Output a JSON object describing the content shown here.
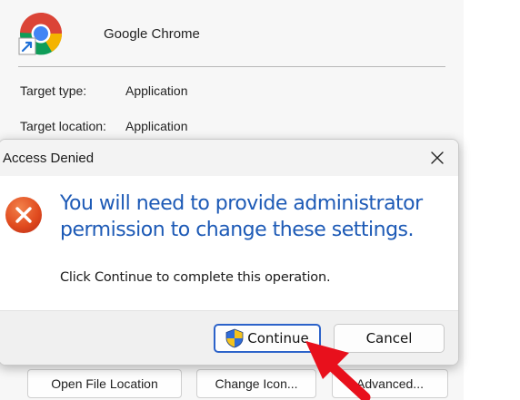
{
  "properties_window": {
    "app_name": "Google Chrome",
    "rows": [
      {
        "label": "Target type:",
        "value": "Application"
      },
      {
        "label": "Target location:",
        "value": "Application"
      }
    ],
    "buttons": {
      "open_file_location": "Open File Location",
      "change_icon": "Change Icon...",
      "advanced": "Advanced..."
    },
    "icon": "chrome-shortcut-icon"
  },
  "dialog": {
    "title": "Access Denied",
    "main_instruction": "You will need to provide administrator permission to change these settings.",
    "content": "Click Continue to complete this operation.",
    "continue_label": "Continue",
    "cancel_label": "Cancel",
    "icons": {
      "error": "error-icon",
      "close": "close-icon",
      "shield": "uac-shield-icon"
    }
  },
  "annotation": {
    "arrow": "red-arrow-icon",
    "color": "#e8101c"
  },
  "colors": {
    "instruction_text": "#1d5ab6",
    "focus_border": "#2b62c9",
    "error_red": "#e04a1e"
  }
}
